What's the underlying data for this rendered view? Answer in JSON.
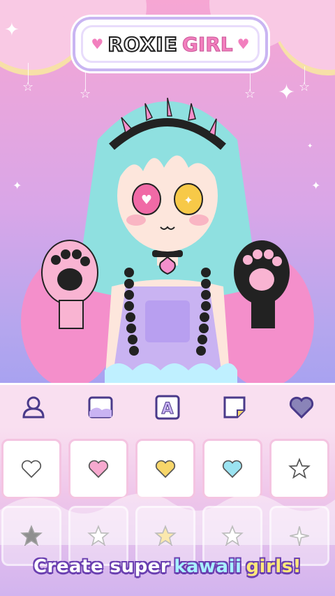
{
  "app": {
    "title_part1": "ROXIE",
    "title_part2": "GIRL"
  },
  "tabs": [
    {
      "name": "body",
      "icon": "person-icon"
    },
    {
      "name": "background",
      "icon": "landscape-icon"
    },
    {
      "name": "text",
      "icon": "letter-a-icon"
    },
    {
      "name": "sticker",
      "icon": "sticker-icon"
    },
    {
      "name": "favorites",
      "icon": "heart-icon"
    }
  ],
  "tiles_row1": [
    {
      "icon": "heart-outline-icon",
      "color": "#ffffff"
    },
    {
      "icon": "heart-icon",
      "color": "#f7a9cf"
    },
    {
      "icon": "heart-icon",
      "color": "#f7d66a"
    },
    {
      "icon": "heart-icon",
      "color": "#9be3f1"
    },
    {
      "icon": "star-outline-icon",
      "color": "#ffffff"
    }
  ],
  "tiles_row2": [
    {
      "icon": "star-icon",
      "color": "#333333"
    },
    {
      "icon": "star-outline-icon",
      "color": "#ffffff"
    },
    {
      "icon": "star-icon",
      "color": "#f7d66a"
    },
    {
      "icon": "star-outline-icon",
      "color": "#ffffff"
    },
    {
      "icon": "sparkle-icon",
      "color": "#999999"
    }
  ],
  "caption": {
    "part1": "Create super",
    "part2": "kawaii",
    "part3": "girls!"
  },
  "colors": {
    "accent_pink": "#f27fbe",
    "accent_purple": "#6a3fb0",
    "panel": "#f9dff0"
  }
}
